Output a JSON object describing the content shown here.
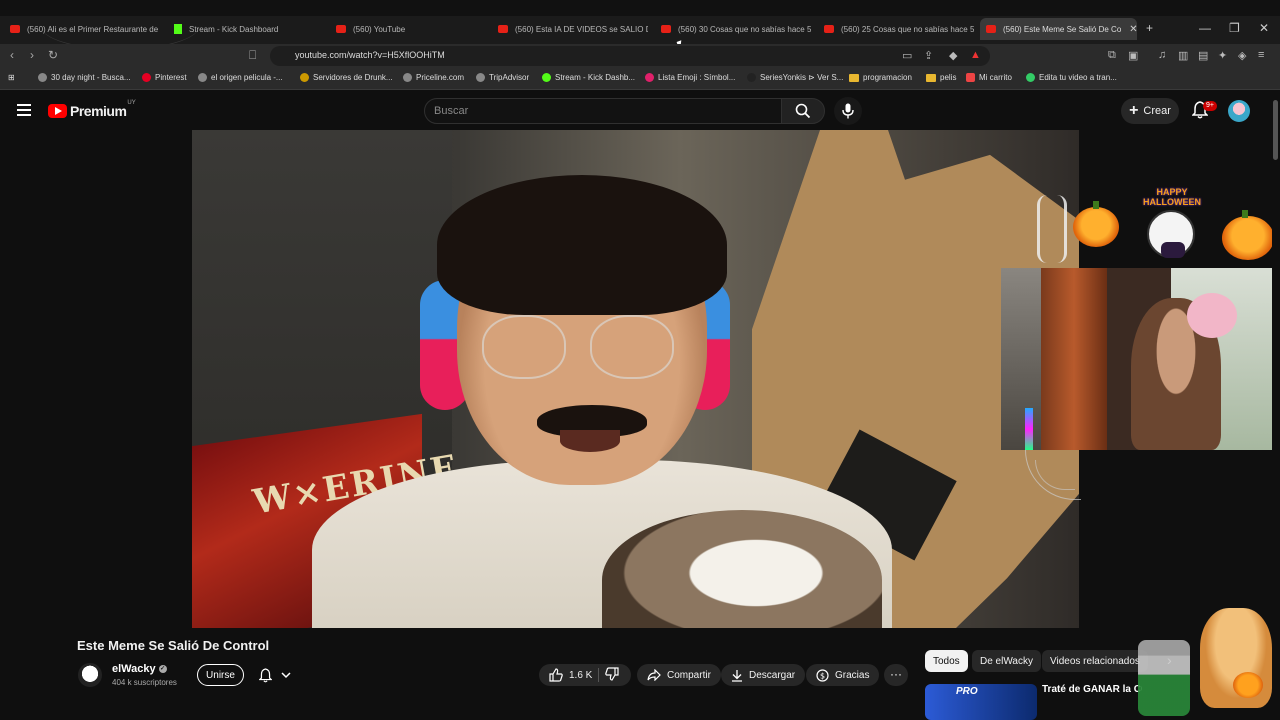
{
  "browser": {
    "tabs": [
      {
        "label": "(560) Ali es el Primer Restaurante de",
        "active": false
      },
      {
        "label": "Stream - Kick Dashboard",
        "active": false
      },
      {
        "label": "(560) YouTube",
        "active": false
      },
      {
        "label": "(560) Esta IA DE VIDEOS se SALIO DE",
        "active": false
      },
      {
        "label": "(560) 30 Cosas que no sabías hace 5",
        "active": false
      },
      {
        "label": "(560) 25 Cosas que no sabías hace 5",
        "active": false
      },
      {
        "label": "(560) Este Meme Se Salió De Co",
        "active": true
      }
    ],
    "url": "youtube.com/watch?v=H5XflOOHiTM",
    "bookmarks": [
      "30 day night - Busca...",
      "Pinterest",
      "el origen pelicula -...",
      "Servidores de Drunk...",
      "Priceline.com",
      "TripAdvisor",
      "Stream - Kick Dashb...",
      "Lista Emoji : Símbol...",
      "SeriesYonkis ⊳ Ver S...",
      "programacion",
      "pelis",
      "Mi carrito",
      "Edita tu video a tran..."
    ]
  },
  "youtube": {
    "logo_text": "Premium",
    "logo_region": "UY",
    "search_placeholder": "Buscar",
    "create_label": "Crear",
    "notifications_badge": "9+"
  },
  "video": {
    "poster_text": "W×ERINE",
    "overlay_text": "HAPPY HALLOWEEN"
  },
  "watch": {
    "title": "Este Meme Se Salió De Control",
    "channel_name": "elWacky",
    "subscribers": "404 k suscriptores",
    "join_label": "Unirse",
    "likes": "1.6 K",
    "share_label": "Compartir",
    "download_label": "Descargar",
    "thanks_label": "Gracias"
  },
  "related": {
    "chips": [
      "Todos",
      "De elWacky",
      "Videos relacionados"
    ],
    "selected_chip": "Todos",
    "first_video": {
      "thumb_text": "PRO",
      "title": "Traté de GANAR la CO... MERLINA con un PRO..."
    }
  },
  "colors": {
    "youtube_red": "#ff0000",
    "background": "#0f0f0f",
    "pill": "#272727"
  }
}
